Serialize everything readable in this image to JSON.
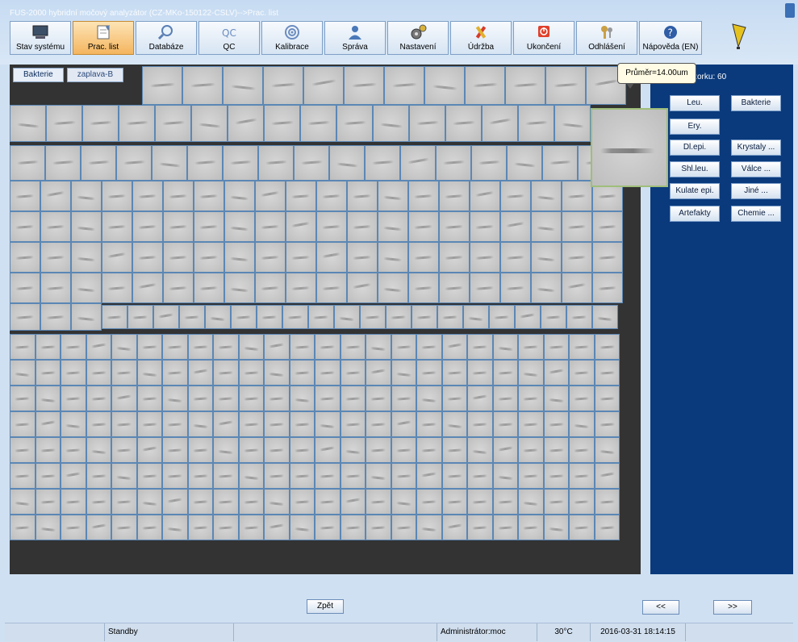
{
  "app": {
    "title": "FUS-2000 hybridní močový analyzátor (CZ-MKo-150122-CSLV)-->Prac. list"
  },
  "toolbar": [
    {
      "id": "stav",
      "label": "Stav systému",
      "icon": "monitor-icon"
    },
    {
      "id": "prac",
      "label": "Prac. list",
      "icon": "worksheet-icon",
      "active": true
    },
    {
      "id": "databaze",
      "label": "Databáze",
      "icon": "magnifier-icon"
    },
    {
      "id": "qc",
      "label": "QC",
      "icon": "qc-icon"
    },
    {
      "id": "kalibrace",
      "label": "Kalibrace",
      "icon": "target-icon"
    },
    {
      "id": "sprava",
      "label": "Správa",
      "icon": "user-icon"
    },
    {
      "id": "nastaveni",
      "label": "Nastavení",
      "icon": "gear-icon"
    },
    {
      "id": "udrzba",
      "label": "Údržba",
      "icon": "tools-icon"
    },
    {
      "id": "ukonceni",
      "label": "Ukončení",
      "icon": "power-icon"
    },
    {
      "id": "odhlaseni",
      "label": "Odhlášení",
      "icon": "keys-icon"
    },
    {
      "id": "napoveda",
      "label": "Nápověda (EN)",
      "icon": "help-icon"
    }
  ],
  "gallery": {
    "tabs": [
      "Bakterie",
      "zaplava-B"
    ]
  },
  "tooltip": {
    "text": "Průměr=14.00um"
  },
  "panel": {
    "count": "vzorku: 60",
    "buttons": [
      "Leu.",
      "Bakterie",
      "Ery.",
      "Dl.epi.",
      "Krystaly ...",
      "Shl.leu.",
      "Válce ...",
      "Kulate epi.",
      "Jiné ...",
      "Artefakty",
      "Chemie ..."
    ]
  },
  "nav": {
    "back": "Zpět",
    "prev": "<<",
    "next": ">>"
  },
  "status": {
    "state": "Standby",
    "user": "Administrátor:moc",
    "temp": "30°C",
    "datetime": "2016-03-31 18:14:15"
  },
  "colors": {
    "header_title": "#ffffff",
    "panel_bg": "#0a3a7c",
    "gallery_bg": "#333333",
    "active_tab": "#f4b55f"
  }
}
